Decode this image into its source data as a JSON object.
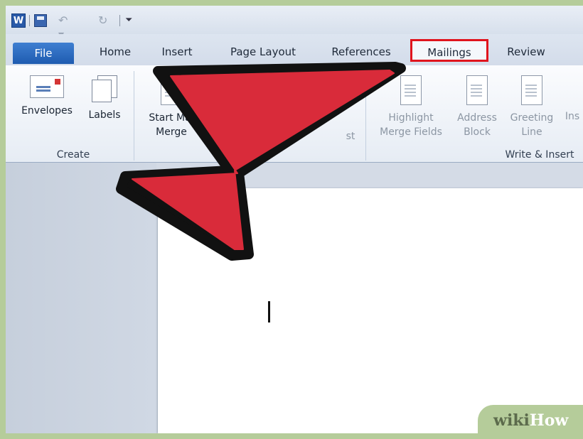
{
  "qat": {
    "app_icon_letter": "W",
    "icons": [
      "word-logo-icon",
      "save-icon",
      "undo-icon",
      "redo-icon",
      "customize-menu-icon"
    ]
  },
  "tabs": {
    "file": "File",
    "home": "Home",
    "insert": "Insert",
    "page_layout": "Page Layout",
    "references": "References",
    "mailings": "Mailings",
    "review": "Review"
  },
  "ribbon": {
    "create_group": {
      "label": "Create",
      "envelopes": "Envelopes",
      "labels": "Labels"
    },
    "start_group": {
      "start_mail_merge_line1": "Start Mai",
      "start_mail_merge_line2": "Merge",
      "partial_list": "st"
    },
    "write_insert_group": {
      "label": "Write & Insert",
      "highlight_line1": "Highlight",
      "highlight_line2": "Merge Fields",
      "address_line1": "Address",
      "address_line2": "Block",
      "greeting_line1": "Greeting",
      "greeting_line2": "Line",
      "insert_partial": "Ins"
    }
  },
  "colors": {
    "highlight_box": "#e0141d",
    "arrow_fill": "#d92b3a",
    "file_tab": "#2a67be"
  },
  "watermark": {
    "wiki": "wiki",
    "how": "How"
  }
}
